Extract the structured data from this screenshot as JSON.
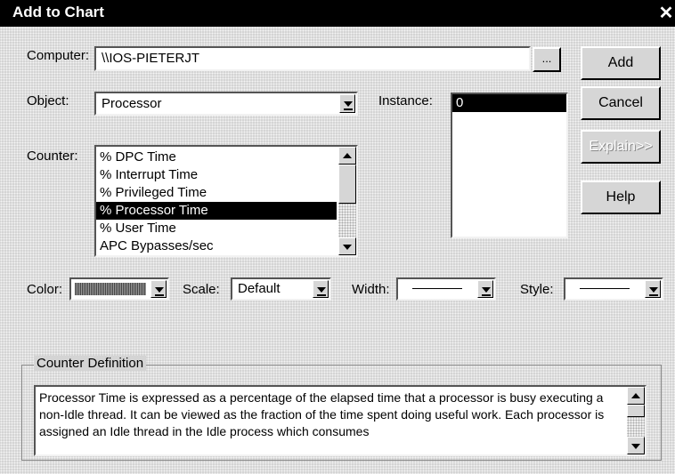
{
  "window": {
    "title": "Add to Chart",
    "close_glyph": "✕"
  },
  "computer": {
    "label": "Computer:",
    "value": "\\\\IOS-PIETERJT",
    "browse_label": "..."
  },
  "object": {
    "label": "Object:",
    "value": "Processor"
  },
  "instance": {
    "label": "Instance:",
    "items": [
      "0"
    ],
    "selected_index": 0
  },
  "counter": {
    "label": "Counter:",
    "items": [
      "% DPC Time",
      "% Interrupt Time",
      "% Privileged Time",
      "% Processor Time",
      "% User Time",
      "APC Bypasses/sec"
    ],
    "selected_index": 3
  },
  "buttons": {
    "add": "Add",
    "cancel": "Cancel",
    "explain": "Explain>>",
    "help": "Help"
  },
  "options": {
    "color_label": "Color:",
    "scale_label": "Scale:",
    "scale_value": "Default",
    "width_label": "Width:",
    "style_label": "Style:"
  },
  "definition": {
    "label": "Counter Definition",
    "text": "Processor Time is expressed as a percentage of the elapsed time that a processor is busy executing a non-Idle thread.  It can be viewed as the fraction of the time spent doing useful work.  Each processor is assigned an Idle thread in the Idle process which consumes"
  },
  "colors": {
    "titlebar": "#000000",
    "selection": "#000000",
    "color_swatch": "#777777"
  }
}
